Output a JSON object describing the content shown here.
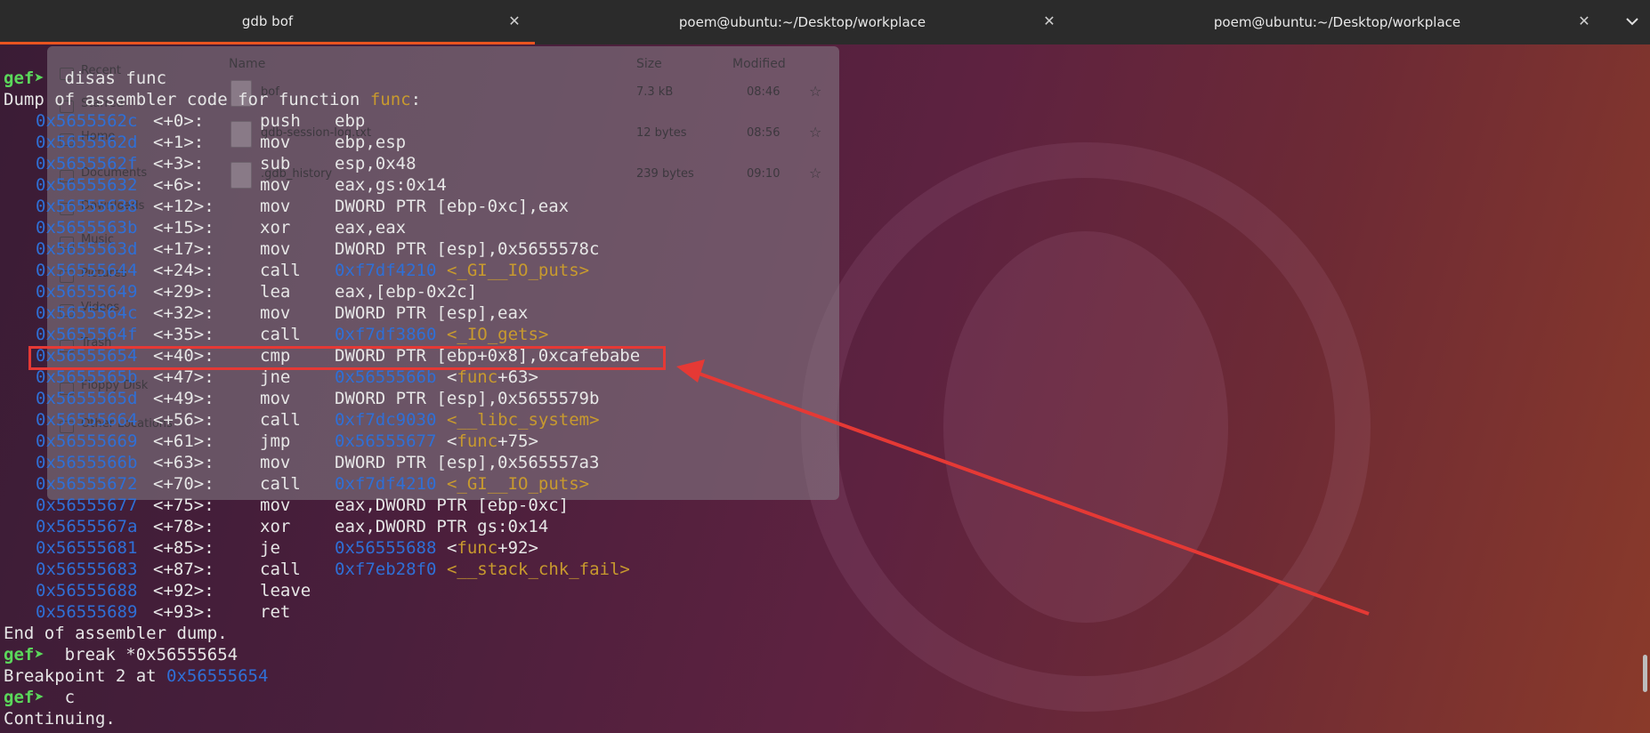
{
  "tabs": [
    {
      "label": "gdb bof",
      "active": true
    },
    {
      "label": "poem@ubuntu:~/Desktop/workplace",
      "active": false
    },
    {
      "label": "poem@ubuntu:~/Desktop/workplace",
      "active": false
    }
  ],
  "icons": {
    "close": "close-icon",
    "menu": "chevron-down-icon"
  },
  "colors": {
    "prompt": "#5bd85b",
    "address": "#2f6fd6",
    "symbol": "#c89a2e",
    "highlight": "#e53935",
    "active_tab": "#e95420"
  },
  "file_manager": {
    "sidebar": [
      "Recent",
      "Starred",
      "Home",
      "Documents",
      "Downloads",
      "Music",
      "Pictures",
      "Videos",
      "Trash",
      "Floppy Disk",
      "Other Locations"
    ],
    "header": {
      "name": "Name",
      "size": "Size",
      "modified": "Modified"
    },
    "files": [
      {
        "name": "bof",
        "size": "7.3 kB",
        "modified": "08:46"
      },
      {
        "name": "gdb-session-log.txt",
        "size": "12 bytes",
        "modified": "08:56"
      },
      {
        "name": ".gdb_history",
        "size": "239 bytes",
        "modified": "09:10"
      }
    ]
  },
  "terminal": {
    "prompt": "gef➤",
    "cmd1": "disas func",
    "dump_prefix": "Dump of assembler code for function ",
    "dump_func": "func",
    "dump_suffix": ":",
    "instructions": [
      {
        "addr": "0x5655562c",
        "off": "<+0>:",
        "op": "push",
        "args": "ebp"
      },
      {
        "addr": "0x5655562d",
        "off": "<+1>:",
        "op": "mov",
        "args": "ebp,esp"
      },
      {
        "addr": "0x5655562f",
        "off": "<+3>:",
        "op": "sub",
        "args": "esp,0x48"
      },
      {
        "addr": "0x56555632",
        "off": "<+6>:",
        "op": "mov",
        "args": "eax,gs:0x14"
      },
      {
        "addr": "0x56555638",
        "off": "<+12>:",
        "op": "mov",
        "args": "DWORD PTR [ebp-0xc],eax"
      },
      {
        "addr": "0x5655563b",
        "off": "<+15>:",
        "op": "xor",
        "args": "eax,eax"
      },
      {
        "addr": "0x5655563d",
        "off": "<+17>:",
        "op": "mov",
        "args": "DWORD PTR [esp],0x5655578c"
      },
      {
        "addr": "0x56555644",
        "off": "<+24>:",
        "op": "call",
        "target": "0xf7df4210",
        "sym": "<_GI__IO_puts>"
      },
      {
        "addr": "0x56555649",
        "off": "<+29>:",
        "op": "lea",
        "args": "eax,[ebp-0x2c]"
      },
      {
        "addr": "0x5655564c",
        "off": "<+32>:",
        "op": "mov",
        "args": "DWORD PTR [esp],eax"
      },
      {
        "addr": "0x5655564f",
        "off": "<+35>:",
        "op": "call",
        "target": "0xf7df3860",
        "sym": "<_IO_gets>"
      },
      {
        "addr": "0x56555654",
        "off": "<+40>:",
        "op": "cmp",
        "args": "DWORD PTR [ebp+0x8],0xcafebabe"
      },
      {
        "addr": "0x5655565b",
        "off": "<+47>:",
        "op": "jne",
        "target": "0x5655566b",
        "sym_pre": "<",
        "sym_fn": "func",
        "sym_post": "+63>"
      },
      {
        "addr": "0x5655565d",
        "off": "<+49>:",
        "op": "mov",
        "args": "DWORD PTR [esp],0x5655579b"
      },
      {
        "addr": "0x56555664",
        "off": "<+56>:",
        "op": "call",
        "target": "0xf7dc9030",
        "sym": "<__libc_system>"
      },
      {
        "addr": "0x56555669",
        "off": "<+61>:",
        "op": "jmp",
        "target": "0x56555677",
        "sym_pre": "<",
        "sym_fn": "func",
        "sym_post": "+75>"
      },
      {
        "addr": "0x5655566b",
        "off": "<+63>:",
        "op": "mov",
        "args": "DWORD PTR [esp],0x565557a3"
      },
      {
        "addr": "0x56555672",
        "off": "<+70>:",
        "op": "call",
        "target": "0xf7df4210",
        "sym": "<_GI__IO_puts>"
      },
      {
        "addr": "0x56555677",
        "off": "<+75>:",
        "op": "mov",
        "args": "eax,DWORD PTR [ebp-0xc]"
      },
      {
        "addr": "0x5655567a",
        "off": "<+78>:",
        "op": "xor",
        "args": "eax,DWORD PTR gs:0x14"
      },
      {
        "addr": "0x56555681",
        "off": "<+85>:",
        "op": "je",
        "target": "0x56555688",
        "sym_pre": "<",
        "sym_fn": "func",
        "sym_post": "+92>"
      },
      {
        "addr": "0x56555683",
        "off": "<+87>:",
        "op": "call",
        "target": "0xf7eb28f0",
        "sym": "<__stack_chk_fail>"
      },
      {
        "addr": "0x56555688",
        "off": "<+92>:",
        "op": "leave",
        "args": ""
      },
      {
        "addr": "0x56555689",
        "off": "<+93>:",
        "op": "ret",
        "args": ""
      }
    ],
    "end_dump": "End of assembler dump.",
    "cmd2": "break *0x56555654",
    "bp_prefix": "Breakpoint 2 at ",
    "bp_addr": "0x56555654",
    "cmd3": "c",
    "continuing": "Continuing."
  }
}
